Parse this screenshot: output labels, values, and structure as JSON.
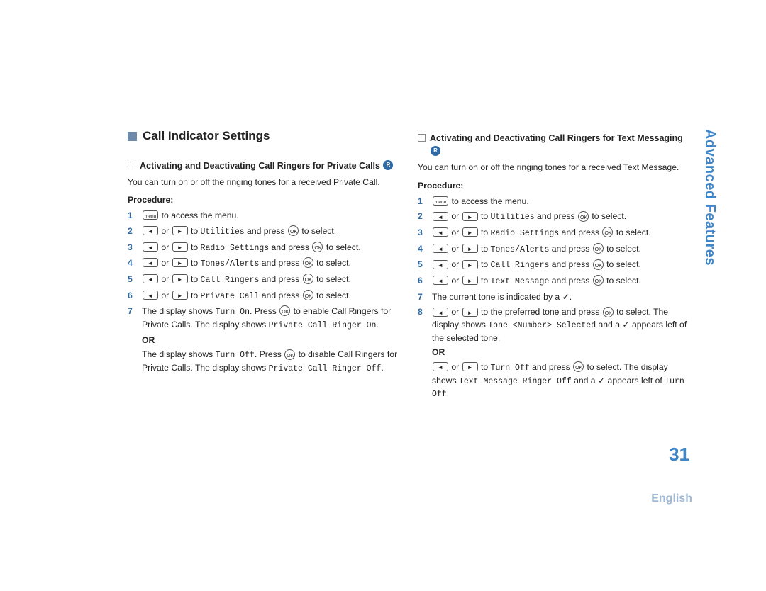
{
  "sidebar": {
    "label": "Advanced Features"
  },
  "page_number": "31",
  "language": "English",
  "section_title": "Call Indicator Settings",
  "left": {
    "subheading": "Activating and Deactivating Call Ringers for Private Calls",
    "badge": "R",
    "intro": "You can turn on or off the ringing tones for a received Private Call.",
    "procedure_label": "Procedure:",
    "steps": [
      {
        "n": "1",
        "pre": "",
        "tail": " to access the menu.",
        "icons": [
          "menu"
        ]
      },
      {
        "n": "2",
        "pre": "",
        "mid_to": "Utilities",
        "icons": [
          "left",
          "or",
          "right"
        ],
        "ok": true,
        "tail": " to select."
      },
      {
        "n": "3",
        "pre": "",
        "mid_to": "Radio Settings",
        "icons": [
          "left",
          "or",
          "right"
        ],
        "ok": true,
        "tail": " to select."
      },
      {
        "n": "4",
        "pre": "",
        "mid_to": "Tones/Alerts",
        "icons": [
          "left",
          "or",
          "right"
        ],
        "ok": true,
        "tail": " to select."
      },
      {
        "n": "5",
        "pre": "",
        "mid_to": "Call Ringers",
        "icons": [
          "left",
          "or",
          "right"
        ],
        "ok": true,
        "tail": " to select."
      },
      {
        "n": "6",
        "pre": "",
        "mid_to": "Private Call",
        "icons": [
          "left",
          "or",
          "right"
        ],
        "ok": true,
        "tail": " to select."
      }
    ],
    "step7a_prefix": "The display shows ",
    "step7a_mono1": "Turn On",
    "step7a_mid": ". Press ",
    "step7a_tail1": " to enable Call Ringers for Private Calls. The display shows ",
    "step7a_mono2": "Private Call Ringer On",
    "step7a_end": ".",
    "or_label": "OR",
    "step7b_prefix": "The display shows ",
    "step7b_mono1": "Turn Off",
    "step7b_mid": ". Press ",
    "step7b_tail1": " to disable Call Ringers for Private Calls. The display shows ",
    "step7b_mono2": "Private Call Ringer Off",
    "step7b_end": "."
  },
  "right": {
    "subheading": "Activating and Deactivating Call Ringers for Text Messaging",
    "badge": "R",
    "intro": "You can turn on or off the ringing tones for a received Text Message.",
    "procedure_label": "Procedure:",
    "steps": [
      {
        "n": "1",
        "tail": " to access the menu.",
        "icons": [
          "menu"
        ]
      },
      {
        "n": "2",
        "mid_to": "Utilities",
        "icons": [
          "left",
          "or",
          "right"
        ],
        "ok": true,
        "tail": " to select."
      },
      {
        "n": "3",
        "mid_to": "Radio Settings",
        "icons": [
          "left",
          "or",
          "right"
        ],
        "ok": true,
        "tail": " to select."
      },
      {
        "n": "4",
        "mid_to": "Tones/Alerts",
        "icons": [
          "left",
          "or",
          "right"
        ],
        "ok": true,
        "tail": " to select."
      },
      {
        "n": "5",
        "mid_to": "Call Ringers",
        "icons": [
          "left",
          "or",
          "right"
        ],
        "ok": true,
        "tail": " to select."
      },
      {
        "n": "6",
        "mid_to": "Text Message",
        "icons": [
          "left",
          "or",
          "right"
        ],
        "ok": true,
        "tail": " to select."
      }
    ],
    "step7": "The current tone is indicated by a ✓.",
    "step8_pre": "",
    "step8_mid": " to the preferred tone and press ",
    "step8_tail": " to select. The display shows ",
    "step8_mono1": "Tone <Number> Selected",
    "step8_after1": " and a ✓ appears left of the selected tone.",
    "or_label": "OR",
    "step8b_pre": "",
    "step8b_mid_to": "Turn Off",
    "step8b_mid2": " and press ",
    "step8b_tail": " to select. The display shows ",
    "step8b_mono1": "Text Message Ringer Off",
    "step8b_after": " and a ✓ appears left of ",
    "step8b_mono2": "Turn Off",
    "step8b_end": "."
  }
}
